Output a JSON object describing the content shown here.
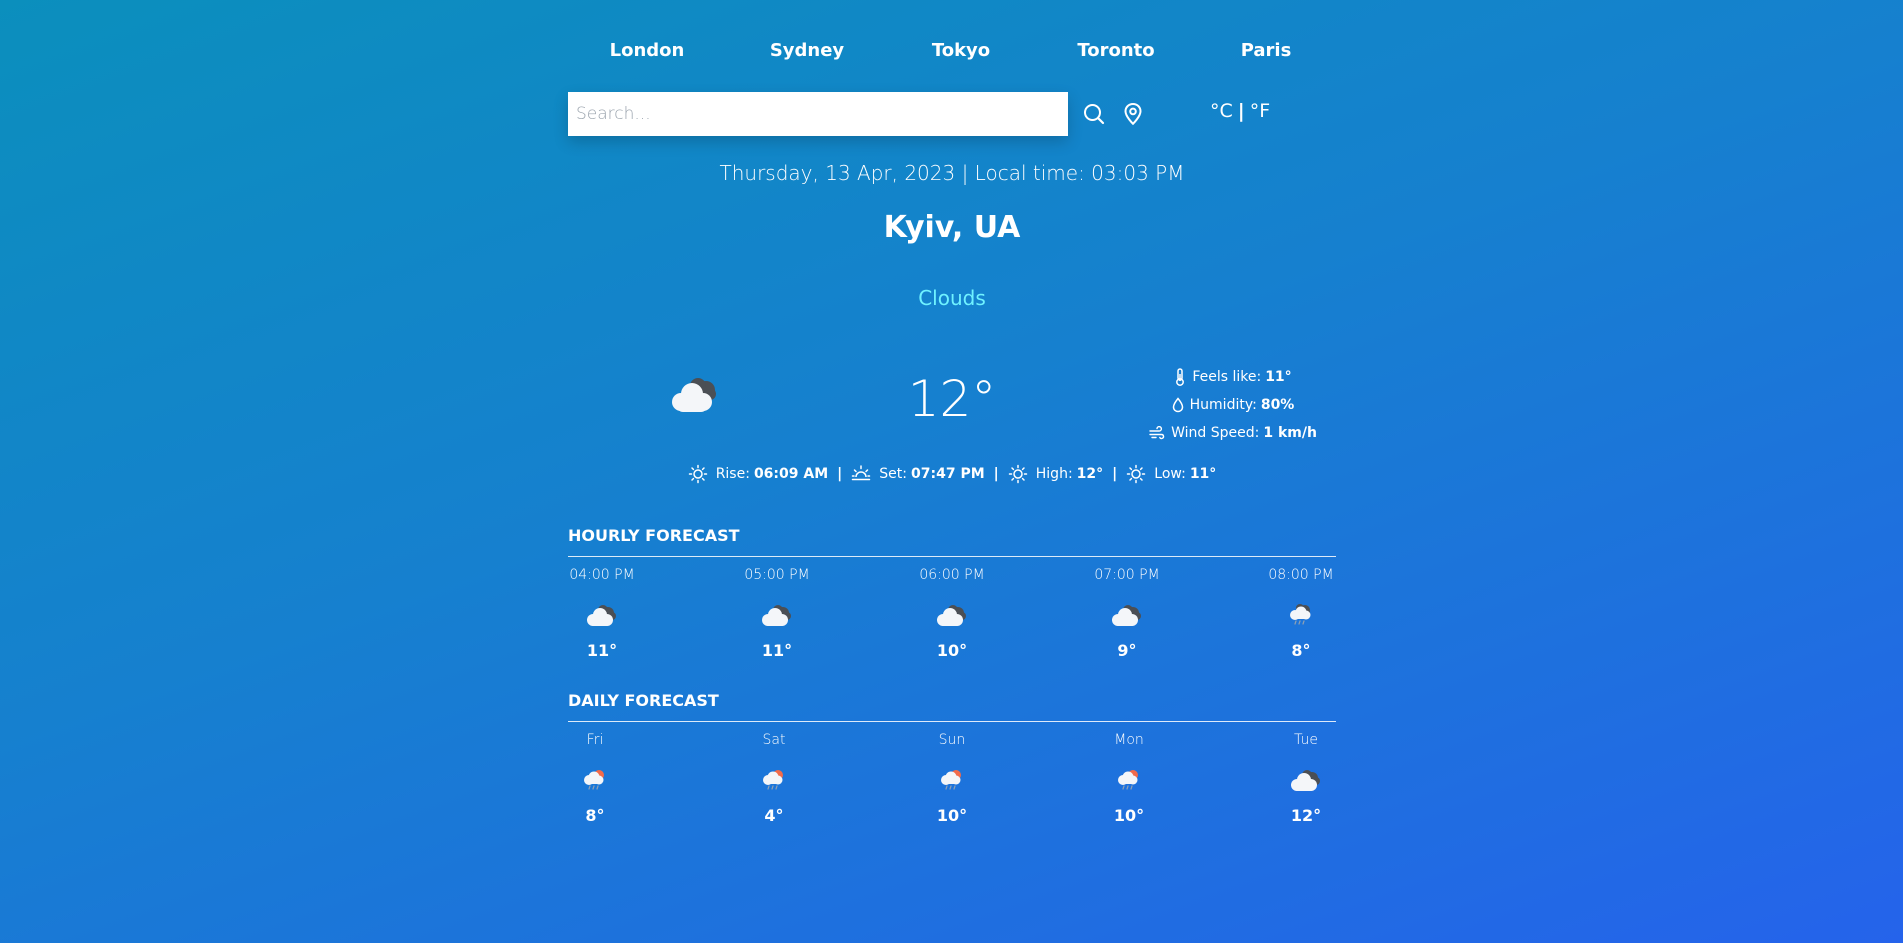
{
  "nav": {
    "cities": [
      "London",
      "Sydney",
      "Tokyo",
      "Toronto",
      "Paris"
    ]
  },
  "search": {
    "placeholder": "Search...",
    "value": ""
  },
  "units": {
    "celsius": "°C",
    "separator": "|",
    "fahrenheit": "°F"
  },
  "header": {
    "datetime": "Thursday, 13 Apr, 2023 | Local time: 03:03 PM",
    "location": "Kyiv, UA",
    "condition": "Clouds"
  },
  "current": {
    "icon": "cloudy-icon",
    "temperature": "12°",
    "feels_like_label": "Feels like:",
    "feels_like": "11°",
    "humidity_label": "Humidity:",
    "humidity": "80%",
    "wind_label": "Wind Speed:",
    "wind": "1 km/h"
  },
  "sun": {
    "rise_label": "Rise:",
    "rise": "06:09 AM",
    "set_label": "Set:",
    "set": "07:47 PM",
    "high_label": "High:",
    "high": "12°",
    "low_label": "Low:",
    "low": "11°",
    "separator": "|"
  },
  "hourly": {
    "title": "HOURLY FORECAST",
    "items": [
      {
        "time": "04:00 PM",
        "temp": "11°",
        "icon": "cloudy-icon"
      },
      {
        "time": "05:00 PM",
        "temp": "11°",
        "icon": "cloudy-icon"
      },
      {
        "time": "06:00 PM",
        "temp": "10°",
        "icon": "cloudy-icon"
      },
      {
        "time": "07:00 PM",
        "temp": "9°",
        "icon": "cloudy-icon"
      },
      {
        "time": "08:00 PM",
        "temp": "8°",
        "icon": "cloud-rain-icon"
      }
    ]
  },
  "daily": {
    "title": "DAILY FORECAST",
    "items": [
      {
        "day": "Fri",
        "temp": "8°",
        "icon": "sun-rain-icon"
      },
      {
        "day": "Sat",
        "temp": "4°",
        "icon": "sun-rain-icon"
      },
      {
        "day": "Sun",
        "temp": "10°",
        "icon": "sun-rain-icon"
      },
      {
        "day": "Mon",
        "temp": "10°",
        "icon": "sun-rain-icon"
      },
      {
        "day": "Tue",
        "temp": "12°",
        "icon": "cloudy-icon"
      }
    ]
  },
  "colors": {
    "condition": "#6ff2ff",
    "dark_cloud": "#4b4f55",
    "light_cloud": "#f4f6f9",
    "sun_accent": "#f26b4a"
  }
}
